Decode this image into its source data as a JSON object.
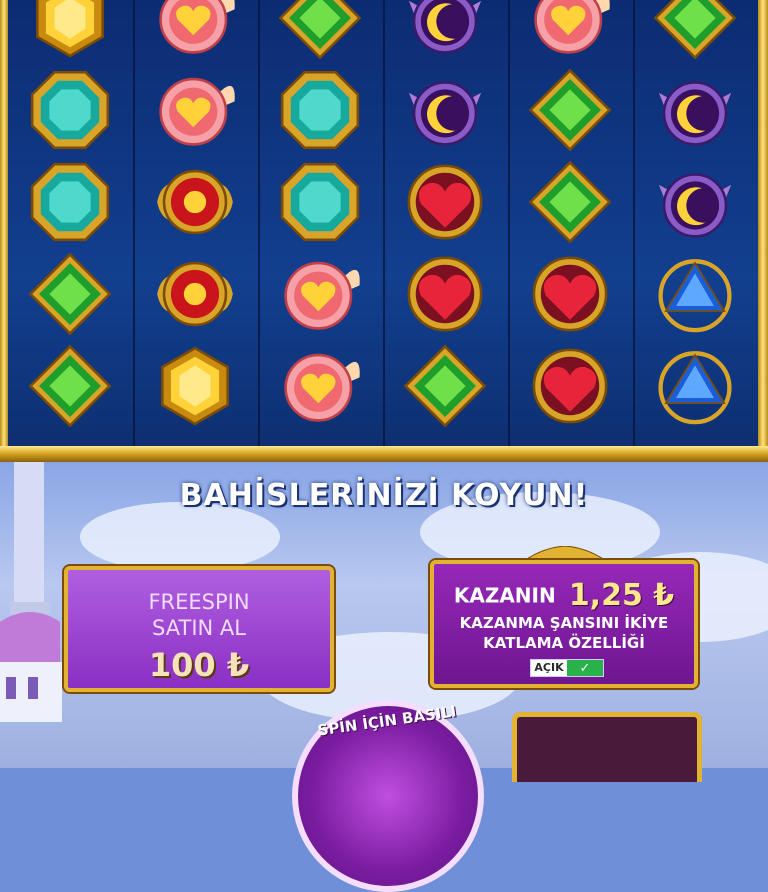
{
  "game": {
    "headline": "BAHİSLERİNİZİ KOYUN!",
    "reels": [
      [
        "gold-gem",
        "teal-gem",
        "teal-gem",
        "green-gem",
        "green-gem"
      ],
      [
        "winged-heart",
        "winged-heart",
        "sun-medallion",
        "sun-medallion",
        "gold-gem"
      ],
      [
        "green-gem",
        "teal-gem",
        "teal-gem",
        "winged-heart",
        "winged-heart"
      ],
      [
        "moon-crest",
        "moon-crest",
        "red-heart",
        "red-heart",
        "green-gem"
      ],
      [
        "winged-heart",
        "green-gem",
        "green-gem",
        "red-heart",
        "red-heart"
      ],
      [
        "green-gem",
        "moon-crest",
        "moon-crest",
        "blue-gem",
        "blue-gem"
      ]
    ]
  },
  "freespin": {
    "line1": "FREESPIN",
    "line2": "SATIN AL",
    "price": "100 ₺"
  },
  "double_chance": {
    "win_label": "KAZANIN",
    "amount": "1,25 ₺",
    "line2": "KAZANMA ŞANSINI İKİYE",
    "line3": "KATLAMA ÖZELLİĞİ",
    "toggle_label": "AÇIK",
    "toggle_icon": "check-icon"
  },
  "spin": {
    "hint": "SPİN İÇİN BASILI"
  },
  "colors": {
    "reel_bg": "#123f8f",
    "gold_frame": "#e2b232",
    "purple_panel": "#8a2fc4",
    "toggle_on": "#29b24a"
  }
}
